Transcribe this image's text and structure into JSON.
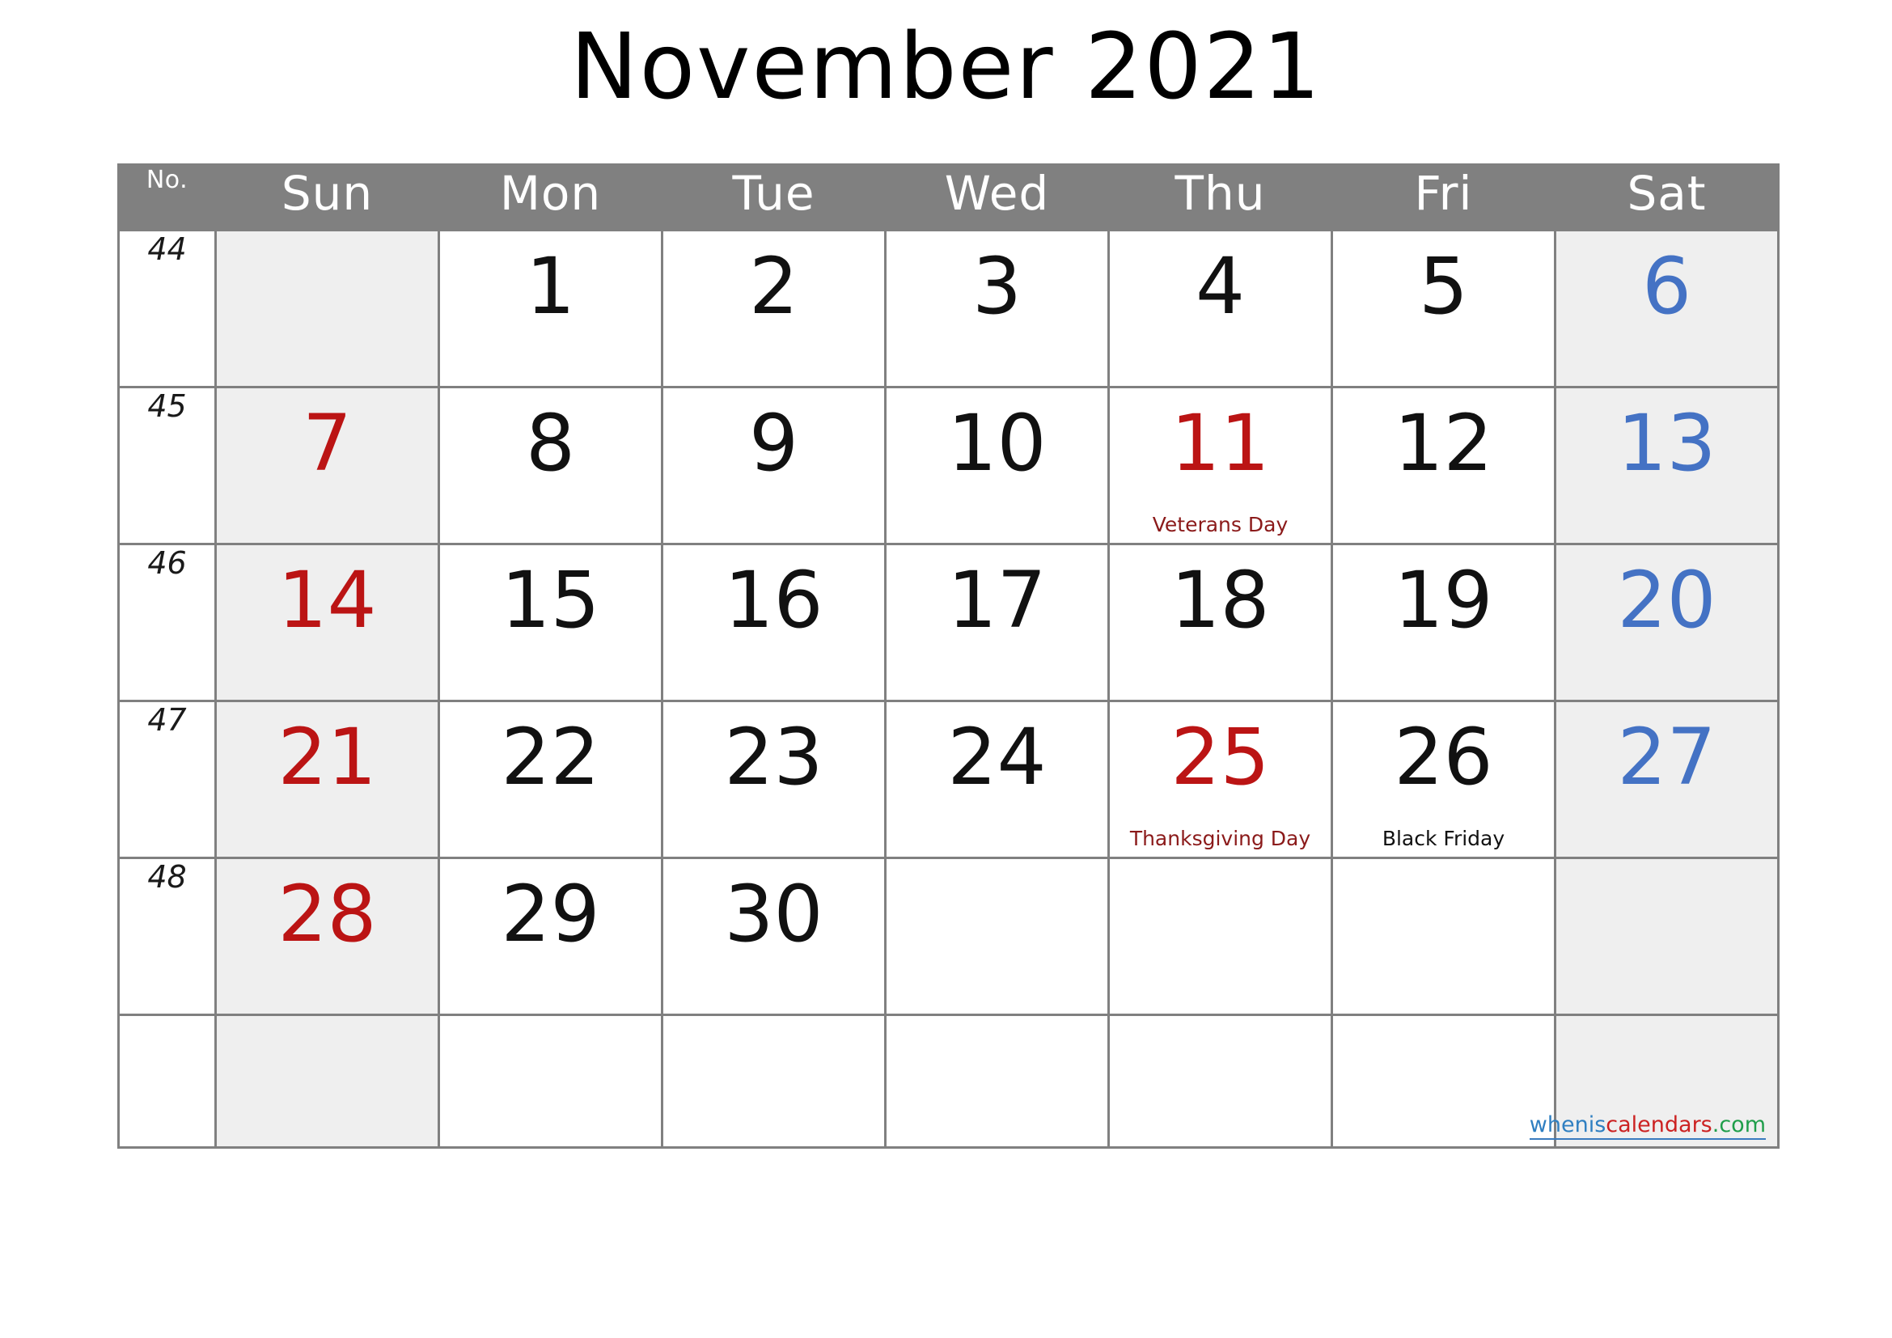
{
  "title": "November 2021",
  "colors": {
    "header_bg": "#808080",
    "header_text": "#ffffff",
    "weekend_bg": "#efefef",
    "sunday_text": "#bb1414",
    "saturday_text": "#4472c4",
    "weekday_text": "#111111",
    "holiday_text": "#8b1a1a",
    "grid_line": "#808080",
    "watermark_blue": "#2f7fc1",
    "watermark_red": "#cc2222",
    "watermark_green": "#1f9e4a"
  },
  "header": {
    "week_no_label": "No.",
    "days": [
      "Sun",
      "Mon",
      "Tue",
      "Wed",
      "Thu",
      "Fri",
      "Sat"
    ]
  },
  "watermark": {
    "part1": "whenis",
    "part2": "calendars",
    "part3": ".com"
  },
  "weeks": [
    {
      "number": "44",
      "cells": [
        {
          "date": "",
          "holiday": ""
        },
        {
          "date": "1",
          "holiday": ""
        },
        {
          "date": "2",
          "holiday": ""
        },
        {
          "date": "3",
          "holiday": ""
        },
        {
          "date": "4",
          "holiday": ""
        },
        {
          "date": "5",
          "holiday": ""
        },
        {
          "date": "6",
          "holiday": ""
        }
      ]
    },
    {
      "number": "45",
      "cells": [
        {
          "date": "7",
          "holiday": ""
        },
        {
          "date": "8",
          "holiday": ""
        },
        {
          "date": "9",
          "holiday": ""
        },
        {
          "date": "10",
          "holiday": ""
        },
        {
          "date": "11",
          "holiday": "Veterans Day"
        },
        {
          "date": "12",
          "holiday": ""
        },
        {
          "date": "13",
          "holiday": ""
        }
      ]
    },
    {
      "number": "46",
      "cells": [
        {
          "date": "14",
          "holiday": ""
        },
        {
          "date": "15",
          "holiday": ""
        },
        {
          "date": "16",
          "holiday": ""
        },
        {
          "date": "17",
          "holiday": ""
        },
        {
          "date": "18",
          "holiday": ""
        },
        {
          "date": "19",
          "holiday": ""
        },
        {
          "date": "20",
          "holiday": ""
        }
      ]
    },
    {
      "number": "47",
      "cells": [
        {
          "date": "21",
          "holiday": ""
        },
        {
          "date": "22",
          "holiday": ""
        },
        {
          "date": "23",
          "holiday": ""
        },
        {
          "date": "24",
          "holiday": ""
        },
        {
          "date": "25",
          "holiday": "Thanksgiving Day"
        },
        {
          "date": "26",
          "holiday": "Black Friday"
        },
        {
          "date": "27",
          "holiday": ""
        }
      ]
    },
    {
      "number": "48",
      "cells": [
        {
          "date": "28",
          "holiday": ""
        },
        {
          "date": "29",
          "holiday": ""
        },
        {
          "date": "30",
          "holiday": ""
        },
        {
          "date": "",
          "holiday": ""
        },
        {
          "date": "",
          "holiday": ""
        },
        {
          "date": "",
          "holiday": ""
        },
        {
          "date": "",
          "holiday": ""
        }
      ]
    },
    {
      "number": "",
      "cells": [
        {
          "date": "",
          "holiday": ""
        },
        {
          "date": "",
          "holiday": ""
        },
        {
          "date": "",
          "holiday": ""
        },
        {
          "date": "",
          "holiday": ""
        },
        {
          "date": "",
          "holiday": ""
        },
        {
          "date": "",
          "holiday": ""
        },
        {
          "date": "",
          "holiday": ""
        }
      ]
    }
  ]
}
